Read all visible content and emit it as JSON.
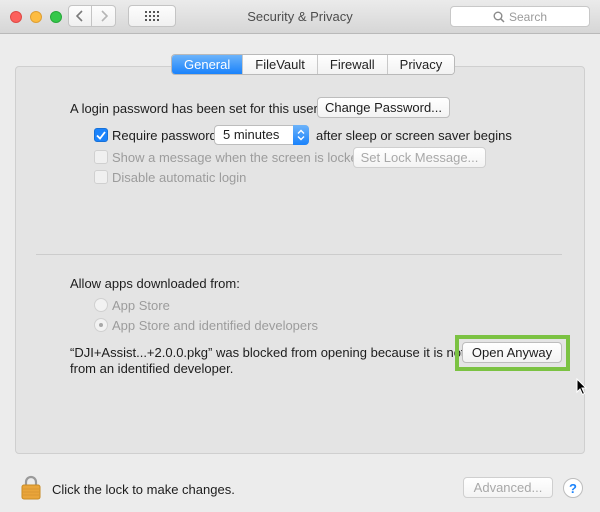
{
  "window": {
    "title": "Security & Privacy",
    "search_placeholder": "Search"
  },
  "tabs": [
    {
      "label": "General",
      "active": true
    },
    {
      "label": "FileVault",
      "active": false
    },
    {
      "label": "Firewall",
      "active": false
    },
    {
      "label": "Privacy",
      "active": false
    }
  ],
  "general": {
    "login_password_text": "A login password has been set for this user",
    "change_password_label": "Change Password...",
    "require_password_label": "Require password",
    "require_password_checked": true,
    "require_password_delay": "5 minutes",
    "after_sleep_text": "after sleep or screen saver begins",
    "show_message_label": "Show a message when the screen is locked",
    "set_lock_message_label": "Set Lock Message...",
    "disable_auto_login_label": "Disable automatic login"
  },
  "allow_apps": {
    "heading": "Allow apps downloaded from:",
    "option_app_store": "App Store",
    "option_identified": "App Store and identified developers",
    "selected": "App Store and identified developers",
    "blocked_line1": "“DJI+Assist...+2.0.0.pkg” was blocked from opening because it is not",
    "blocked_line2": "from an identified developer.",
    "open_anyway_label": "Open Anyway"
  },
  "footer": {
    "lock_text": "Click the lock to make changes.",
    "advanced_label": "Advanced...",
    "help_label": "?"
  },
  "colors": {
    "accent_blue": "#1b83fb",
    "highlight_green": "#7bc242"
  }
}
